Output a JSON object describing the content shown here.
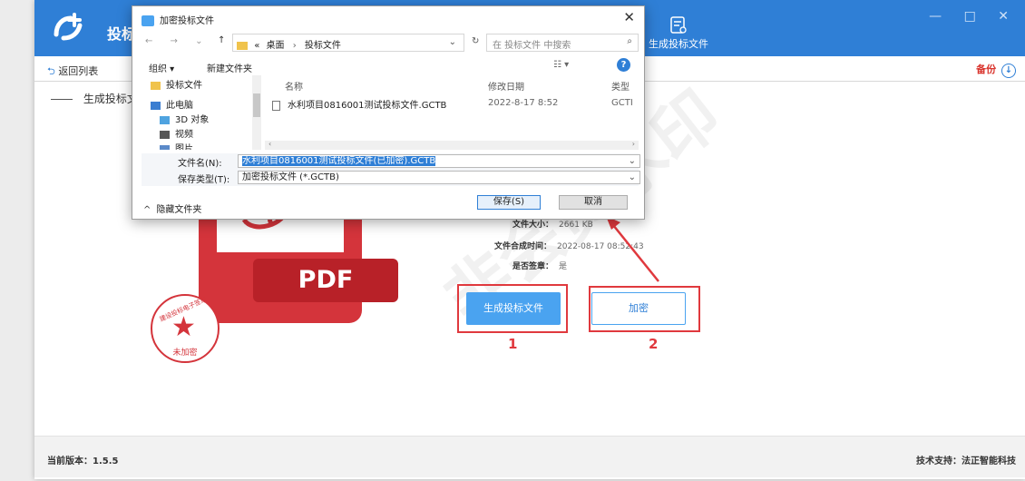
{
  "app": {
    "title": "投标",
    "generate_tab_label": "生成投标文件",
    "window_controls": "— □ ✕",
    "back_label": "返回列表",
    "backup_label": "备份",
    "section_title": "生成投标文",
    "version": "当前版本：1.5.5",
    "support": "技术支持：法正智能科技",
    "watermark": "非会员水印"
  },
  "document": {
    "pdf_label": "PDF",
    "stamp_arc": "建设投标电子签章",
    "stamp_text": "未加密",
    "file_size_label": "文件大小：",
    "file_size_value": "2661 KB",
    "time_label": "文件合成时间：",
    "time_value": "2022-08-17 08:52:43",
    "signed_label": "是否签章：",
    "signed_value": "是",
    "btn_generate": "生成投标文件",
    "btn_encrypt": "加密",
    "marker_1": "1",
    "marker_2": "2"
  },
  "dialog": {
    "title": "加密投标文件",
    "close": "✕",
    "nav_arrows": "← → ⌄",
    "nav_up": "↑",
    "crumb_prefix": "«",
    "crumb_1": "桌面",
    "crumb_2": "投标文件",
    "refresh": "↻",
    "search_placeholder": "在 投标文件 中搜索",
    "toolbar_org": "组织 ▾",
    "toolbar_new_folder": "新建文件夹",
    "toolbar_view": "☷ ▾",
    "help": "?",
    "nav_items": [
      "投标文件",
      "此电脑",
      "3D 对象",
      "视频",
      "图片"
    ],
    "col_name": "名称",
    "col_modified": "修改日期",
    "col_type": "类型",
    "file_name": "水利项目0816001测试投标文件.GCTB",
    "file_date": "2022-8-17 8:52",
    "file_type": "GCTI",
    "filename_label": "文件名(N):",
    "filename_value": "水利项目0816001测试投标文件(已加密).GCTB",
    "savetype_label": "保存类型(T):",
    "savetype_value": "加密投标文件 (*.GCTB)",
    "hide_folder": "隐藏文件夹",
    "save_btn": "保存(S)",
    "cancel_btn": "取消"
  },
  "colors": {
    "accent": "#2f7fd6",
    "pdf_red": "#d4343b",
    "annotation_red": "#e0393e",
    "button_blue": "#4aa3f0"
  }
}
